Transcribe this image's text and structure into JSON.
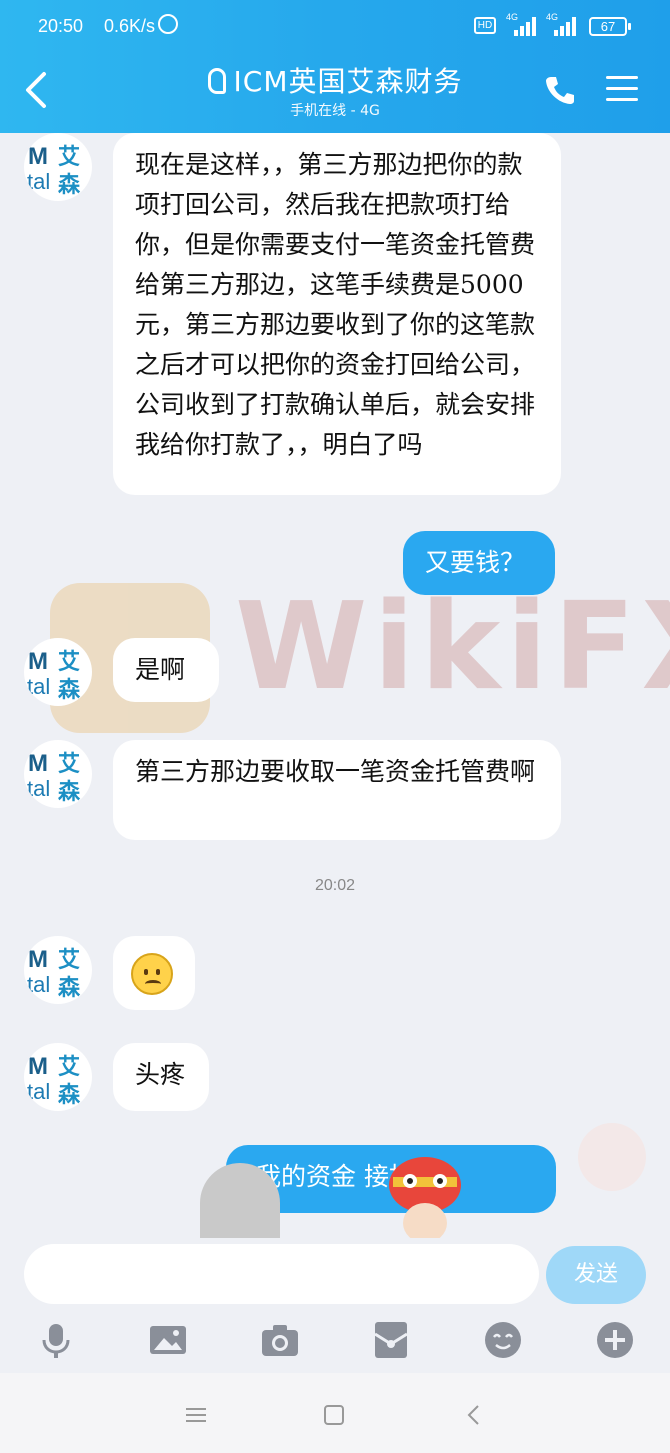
{
  "status_bar": {
    "time": "20:50",
    "speed": "0.6K/s",
    "hd": "HD",
    "net1": "4G",
    "net2": "4G",
    "battery": "67"
  },
  "header": {
    "title": "ICM英国艾森财务",
    "subtitle": "手机在线 - 4G",
    "colors": {
      "accent": "#26a8ec"
    }
  },
  "contact_avatar": {
    "m": "M",
    "tal": "tal",
    "ai": "艾",
    "sen": "森"
  },
  "messages": [
    {
      "side": "in",
      "text": "现在是这样，，第三方那边把你的款项打回公司，然后我在把款项打给你，但是你需要支付一笔资金托管费给第三方那边，这笔手续费是5000元，第三方那边要收到了你的这笔款之后才可以把你的资金打回给公司，公司收到了打款确认单后，就会安排我给你打款了，，明白了吗"
    },
    {
      "side": "out",
      "text": "又要钱？"
    },
    {
      "side": "in",
      "text": "是啊"
    },
    {
      "side": "in",
      "text": "第三方那边要收取一笔资金托管费啊"
    },
    {
      "side": "separator",
      "text": "20:02"
    },
    {
      "side": "in",
      "type": "emoji",
      "emoji": "frowning-face"
    },
    {
      "side": "in",
      "text": "头疼"
    },
    {
      "side": "out",
      "text": "我的资金 接扣掉"
    }
  ],
  "watermark": "WikiFX",
  "input": {
    "placeholder": "",
    "send_label": "发送"
  },
  "toolbar": [
    "microphone-icon",
    "image-icon",
    "camera-icon",
    "red-packet-icon",
    "emoji-icon",
    "plus-icon"
  ]
}
